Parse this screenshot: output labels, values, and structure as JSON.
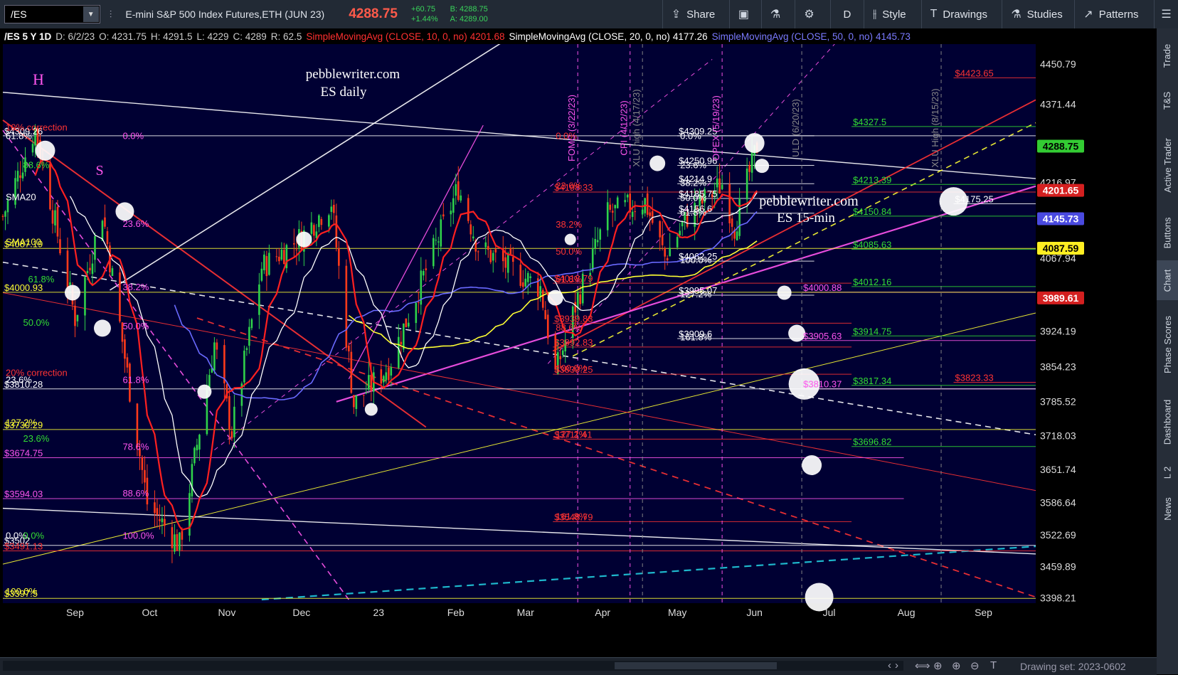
{
  "toolbar": {
    "symbol": "/ES",
    "instrument": "E-mini S&P 500 Index Futures,ETH (JUN 23)",
    "last_price": "4288.75",
    "change": "+60.75",
    "change_pct": "+1.44%",
    "bid": "B: 4288.75",
    "ask": "A: 4289.00",
    "share": "Share",
    "aggregation": "D",
    "style": "Style",
    "drawings": "Drawings",
    "studies": "Studies",
    "patterns": "Patterns"
  },
  "sidebar": [
    "Trade",
    "T&S",
    "Active Trader",
    "Buttons",
    "Chart",
    "Phase Scores",
    "Dashboard",
    "L 2",
    "News"
  ],
  "header": {
    "ident": "/ES 5 Y 1D",
    "date": "D: 6/2/23",
    "open": "O: 4231.75",
    "high": "H: 4291.5",
    "low": "L: 4229",
    "close": "C: 4289",
    "range": "R: 62.5",
    "sma10": "SimpleMovingAvg (CLOSE, 10, 0, no)",
    "sma10_val": "4201.68",
    "sma20": "SimpleMovingAvg (CLOSE, 20, 0, no)",
    "sma20_val": "4177.26",
    "sma50": "SimpleMovingAvg (CLOSE, 50, 0, no)",
    "sma50_val": "4145.73"
  },
  "annotations": {
    "site": "pebblewriter.com",
    "daily": "ES daily",
    "site2": "pebblewriter.com",
    "intraday": "ES 15-min",
    "H": "H",
    "S": "S"
  },
  "footer": {
    "drawing_set": "Drawing set: 2023-0602"
  },
  "colors": {
    "bg": "#000033",
    "up": "#2fd14a",
    "down": "#ff3a1a",
    "sma10": "#ff2020",
    "sma20": "#ffffff",
    "sma50": "#6a6aff",
    "yellow": "#ffff33",
    "pink": "#ff55ee",
    "green": "#33dd33",
    "cyan": "#22ccdd"
  },
  "chart_data": {
    "type": "candlestick",
    "xlabels": [
      "Sep",
      "Oct",
      "Nov",
      "Dec",
      "23",
      "Feb",
      "Mar",
      "Apr",
      "May",
      "Jun",
      "Jul",
      "Aug",
      "Sep"
    ],
    "x_range": [
      "2022-08-03",
      "2023-09-22"
    ],
    "y_ticks": [
      4450.79,
      4371.44,
      4216.97,
      4067.94,
      3924.19,
      3854.23,
      3785.52,
      3718.03,
      3651.74,
      3586.64,
      3522.69,
      3459.89,
      3398.21
    ],
    "y_range": [
      3388,
      4490
    ],
    "price_marker": {
      "value": 4288.75,
      "label": "4288.75",
      "color": "#33cc33"
    },
    "sma10_marker": {
      "value": 4201.65,
      "label": "4201.65",
      "color": "#d42020"
    },
    "sma50_marker": {
      "value": 4145.73,
      "label": "4145.73",
      "color": "#4a4ae0"
    },
    "yellow_marker": {
      "value": 4087.59,
      "label": "4087.59",
      "color": "#ffee22"
    },
    "red_marker": {
      "value": 3989.61,
      "label": "3989.61",
      "color": "#d42020"
    },
    "anchors": [
      [
        "2022-08-03",
        4150
      ],
      [
        "2022-08-16",
        4325
      ],
      [
        "2022-09-01",
        3950
      ],
      [
        "2022-09-12",
        4160
      ],
      [
        "2022-09-30",
        3585
      ],
      [
        "2022-10-13",
        3502
      ],
      [
        "2022-10-27",
        3900
      ],
      [
        "2022-11-03",
        3725
      ],
      [
        "2022-11-15",
        4050
      ],
      [
        "2022-12-01",
        4110
      ],
      [
        "2022-12-13",
        4180
      ],
      [
        "2022-12-22",
        3780
      ],
      [
        "2023-01-05",
        3855
      ],
      [
        "2023-02-02",
        4208
      ],
      [
        "2023-02-10",
        4090
      ],
      [
        "2023-03-07",
        4010
      ],
      [
        "2023-03-13",
        3840
      ],
      [
        "2023-03-22",
        3990
      ],
      [
        "2023-04-03",
        4155
      ],
      [
        "2023-04-18",
        4180
      ],
      [
        "2023-04-26",
        4070
      ],
      [
        "2023-05-05",
        4150
      ],
      [
        "2023-05-19",
        4215
      ],
      [
        "2023-05-24",
        4130
      ],
      [
        "2023-06-02",
        4289
      ]
    ],
    "fib_levels": [
      {
        "value": 4423.65,
        "label": "$4423.65",
        "color": "#ff3333",
        "x1": "2023-08-20",
        "x2": "2023-09-22"
      },
      {
        "value": 4327.5,
        "label": "$4327.5",
        "color": "#33dd33",
        "x1": "2023-07-10",
        "x2": "2023-09-22"
      },
      {
        "value": 4309.26,
        "label": "$4309.26",
        "color": "#ffffff",
        "x1": "2022-08-03",
        "x2": "2023-09-22"
      },
      {
        "value": 4309.25,
        "label": "$4309.25",
        "color": "#ffffff",
        "x1": "2023-05-01",
        "x2": "2023-06-25"
      },
      {
        "value": 4250.96,
        "label": "$4250.96",
        "color": "#ffffff",
        "x1": "2023-05-01",
        "x2": "2023-06-25"
      },
      {
        "value": 4214.9,
        "label": "$4214.9",
        "color": "#ffffff",
        "x1": "2023-05-01",
        "x2": "2023-06-25"
      },
      {
        "value": 4213.39,
        "label": "$4213.39",
        "color": "#33dd33",
        "x1": "2023-07-10",
        "x2": "2023-09-22"
      },
      {
        "value": 4198.33,
        "label": "$4198.33",
        "color": "#ff3333",
        "x1": "2023-03-12",
        "x2": "2023-09-22"
      },
      {
        "value": 4185.75,
        "label": "$4185.75",
        "color": "#ffffff",
        "x1": "2023-05-01",
        "x2": "2023-06-25"
      },
      {
        "value": 4175.25,
        "label": "$4175.25",
        "color": "#ffffff",
        "x1": "2023-08-20",
        "x2": "2023-09-22"
      },
      {
        "value": 4156.6,
        "label": "$4156.6",
        "color": "#ffffff",
        "x1": "2023-05-01",
        "x2": "2023-06-25"
      },
      {
        "value": 4150.84,
        "label": "$4150.84",
        "color": "#33dd33",
        "x1": "2023-07-10",
        "x2": "2023-09-22"
      },
      {
        "value": 4085.63,
        "label": "$4085.63",
        "color": "#33dd33",
        "x1": "2023-07-10",
        "x2": "2023-09-22"
      },
      {
        "value": 4087.19,
        "label": "$4087.19",
        "color": "#ffff33",
        "x1": "2022-08-03",
        "x2": "2023-09-22"
      },
      {
        "value": 4062.25,
        "label": "$4062.25",
        "color": "#ffffff",
        "x1": "2023-05-01",
        "x2": "2023-06-25"
      },
      {
        "value": 4018.79,
        "label": "$4018.79",
        "color": "#ff3333",
        "x1": "2023-03-12",
        "x2": "2023-07-10"
      },
      {
        "value": 4012.16,
        "label": "$4012.16",
        "color": "#33dd33",
        "x1": "2023-07-10",
        "x2": "2023-09-22"
      },
      {
        "value": 4000.88,
        "label": "$4000.88",
        "color": "#ff55ee",
        "x1": "2023-06-20",
        "x2": "2023-09-22"
      },
      {
        "value": 4000.93,
        "label": "$4000.93",
        "color": "#ffff33",
        "x1": "2022-08-03",
        "x2": "2023-09-22"
      },
      {
        "value": 3995.07,
        "label": "$3995.07",
        "color": "#ffffff",
        "x1": "2023-05-01",
        "x2": "2023-06-25"
      },
      {
        "value": 3939.83,
        "label": "$3939.83",
        "color": "#ff3333",
        "x1": "2023-03-12",
        "x2": "2023-07-10"
      },
      {
        "value": 3914.75,
        "label": "$3914.75",
        "color": "#33dd33",
        "x1": "2023-07-10",
        "x2": "2023-09-22"
      },
      {
        "value": 3909.6,
        "label": "$3909.6",
        "color": "#ffffff",
        "x1": "2023-05-01",
        "x2": "2023-06-25"
      },
      {
        "value": 3905.63,
        "label": "$3905.63",
        "color": "#ff55ee",
        "x1": "2023-06-20",
        "x2": "2023-09-22"
      },
      {
        "value": 3892.83,
        "label": "$3892.83",
        "color": "#ff3333",
        "x1": "2023-03-12",
        "x2": "2023-07-10"
      },
      {
        "value": 3839.25,
        "label": "$3839.25",
        "color": "#ff3333",
        "x1": "2023-03-12",
        "x2": "2023-07-10"
      },
      {
        "value": 3823.33,
        "label": "$3823.33",
        "color": "#ff3333",
        "x1": "2023-08-20",
        "x2": "2023-09-22"
      },
      {
        "value": 3817.34,
        "label": "$3817.34",
        "color": "#33dd33",
        "x1": "2023-07-10",
        "x2": "2023-09-22"
      },
      {
        "value": 3810.37,
        "label": "$3810.37",
        "color": "#ff55ee",
        "x1": "2023-06-20",
        "x2": "2023-09-22"
      },
      {
        "value": 3810.28,
        "label": "$3810.28",
        "color": "#ffffff",
        "x1": "2022-08-03",
        "x2": "2023-09-22"
      },
      {
        "value": 3730.29,
        "label": "$3730.29",
        "color": "#ffff33",
        "x1": "2022-08-03",
        "x2": "2023-09-22"
      },
      {
        "value": 3711.41,
        "label": "$3711.41",
        "color": "#ff3333",
        "x1": "2023-03-12",
        "x2": "2023-07-10"
      },
      {
        "value": 3696.82,
        "label": "$3696.82",
        "color": "#33dd33",
        "x1": "2023-07-10",
        "x2": "2023-09-22"
      },
      {
        "value": 3674.75,
        "label": "$3674.75",
        "color": "#ff55ee",
        "x1": "2022-08-03",
        "x2": "2023-07-31"
      },
      {
        "value": 3594.03,
        "label": "$3594.03",
        "color": "#ff55ee",
        "x1": "2022-08-03",
        "x2": "2023-07-31"
      },
      {
        "value": 3548.79,
        "label": "$3548.79",
        "color": "#ff3333",
        "x1": "2023-03-12",
        "x2": "2023-07-10"
      },
      {
        "value": 3502,
        "label": "$3502",
        "color": "#ffffff",
        "x1": "2022-08-03",
        "x2": "2023-09-22"
      },
      {
        "value": 3491.13,
        "label": "$3491.13",
        "color": "#ff3333",
        "x1": "2022-08-03",
        "x2": "2023-09-22"
      },
      {
        "value": 3397.5,
        "label": "$3397.5",
        "color": "#ffff33",
        "x1": "2022-08-03",
        "x2": "2023-09-22"
      }
    ],
    "pct_labels": [
      {
        "t": "2022-08-03",
        "v": 4303,
        "text": "61.8%",
        "color": "#ffffff"
      },
      {
        "t": "2022-09-19",
        "v": 4303,
        "text": "0.0%",
        "color": "#ff55ee"
      },
      {
        "t": "2022-08-10",
        "v": 4245,
        "text": "88.6%",
        "color": "#33dd33"
      },
      {
        "t": "2022-09-19",
        "v": 4130,
        "text": "23.6%",
        "color": "#ff55ee"
      },
      {
        "t": "2022-08-03",
        "v": 4094,
        "text": "SMA100",
        "color": "#ffff33"
      },
      {
        "t": "2022-08-03",
        "v": 4182,
        "text": "SMA20",
        "color": "#ffffff"
      },
      {
        "t": "2022-08-12",
        "v": 4020,
        "text": "61.8%",
        "color": "#33dd33"
      },
      {
        "t": "2022-09-19",
        "v": 4005,
        "text": "38.2%",
        "color": "#ff55ee"
      },
      {
        "t": "2022-08-10",
        "v": 3935,
        "text": "50.0%",
        "color": "#33dd33"
      },
      {
        "t": "2022-09-19",
        "v": 3928,
        "text": "50.0%",
        "color": "#ff55ee"
      },
      {
        "t": "2022-08-03",
        "v": 3822,
        "text": "23.6%",
        "color": "#ffffff"
      },
      {
        "t": "2022-09-19",
        "v": 3822,
        "text": "61.8%",
        "color": "#ff55ee"
      },
      {
        "t": "2022-08-03",
        "v": 3738,
        "text": "127.2%",
        "color": "#ffff33"
      },
      {
        "t": "2022-08-10",
        "v": 3706,
        "text": "23.6%",
        "color": "#33dd33"
      },
      {
        "t": "2022-09-19",
        "v": 3690,
        "text": "78.6%",
        "color": "#ff55ee"
      },
      {
        "t": "2022-09-19",
        "v": 3598,
        "text": "88.6%",
        "color": "#ff55ee"
      },
      {
        "t": "2022-08-03",
        "v": 3515,
        "text": "0.0%",
        "color": "#ffffff"
      },
      {
        "t": "2022-08-10",
        "v": 3515,
        "text": "0.0%",
        "color": "#33dd33"
      },
      {
        "t": "2022-09-19",
        "v": 3515,
        "text": "100.0%",
        "color": "#ff55ee"
      },
      {
        "t": "2022-08-03",
        "v": 3405,
        "text": "100.0%",
        "color": "#ffff33"
      },
      {
        "t": "2022-08-03",
        "v": 4320,
        "text": "10% correction",
        "color": "#ff3333"
      },
      {
        "t": "2022-08-03",
        "v": 3836,
        "text": "20% correction",
        "color": "#ff3333"
      },
      {
        "t": "2023-03-12",
        "v": 4303,
        "text": "0.0%",
        "color": "#ff3333"
      },
      {
        "t": "2023-03-12",
        "v": 4205,
        "text": "23.6%",
        "color": "#ff3333"
      },
      {
        "t": "2023-03-12",
        "v": 4128,
        "text": "38.2%",
        "color": "#ff3333"
      },
      {
        "t": "2023-03-12",
        "v": 4075,
        "text": "50.0%",
        "color": "#ff3333"
      },
      {
        "t": "2023-03-12",
        "v": 4020,
        "text": "61.8%",
        "color": "#ff3333"
      },
      {
        "t": "2023-03-12",
        "v": 3925,
        "text": "88.6%",
        "color": "#ff3333"
      },
      {
        "t": "2023-03-12",
        "v": 3845,
        "text": "100.0%",
        "color": "#ff3333"
      },
      {
        "t": "2023-03-12",
        "v": 3715,
        "text": "127.2%",
        "color": "#ff3333"
      },
      {
        "t": "2023-03-12",
        "v": 3553,
        "text": "161.8%",
        "color": "#ff3333"
      },
      {
        "t": "2023-05-01",
        "v": 4303,
        "text": "0.0%",
        "color": "#ffffff"
      },
      {
        "t": "2023-05-01",
        "v": 4245,
        "text": "23.6%",
        "color": "#ffffff"
      },
      {
        "t": "2023-05-01",
        "v": 4210,
        "text": "38.2%",
        "color": "#ffffff"
      },
      {
        "t": "2023-05-01",
        "v": 4181,
        "text": "50.0%",
        "color": "#ffffff"
      },
      {
        "t": "2023-05-01",
        "v": 4152,
        "text": "61.8%",
        "color": "#ffffff"
      },
      {
        "t": "2023-05-01",
        "v": 4058,
        "text": "100.0%",
        "color": "#ffffff"
      },
      {
        "t": "2023-05-01",
        "v": 3991,
        "text": "127.2%",
        "color": "#ffffff"
      },
      {
        "t": "2023-05-01",
        "v": 3906,
        "text": "161.8%",
        "color": "#ffffff"
      }
    ],
    "events": [
      {
        "t": "2023-03-22",
        "text": "FOMC (3/22/23)",
        "color": "#ff55ee"
      },
      {
        "t": "2023-04-12",
        "text": "CPI (4/12/23)",
        "color": "#ff55ee"
      },
      {
        "t": "2023-04-17",
        "text": "XLU high (4/17/23)",
        "color": "#888888"
      },
      {
        "t": "2023-05-19",
        "text": "OPEX (5/19/23)",
        "color": "#ff55ee"
      },
      {
        "t": "2023-06-20",
        "text": "ULD (6/20/23)",
        "color": "#888888"
      },
      {
        "t": "2023-08-15",
        "text": "XLU High (8/15/23)",
        "color": "#888888"
      }
    ],
    "circles": [
      {
        "t": "2022-08-20",
        "v": 4280,
        "r": 14
      },
      {
        "t": "2022-09-21",
        "v": 4160,
        "r": 13
      },
      {
        "t": "2022-08-31",
        "v": 4000,
        "r": 11
      },
      {
        "t": "2022-09-12",
        "v": 3930,
        "r": 12
      },
      {
        "t": "2022-10-23",
        "v": 3805,
        "r": 10
      },
      {
        "t": "2022-12-02",
        "v": 4105,
        "r": 11
      },
      {
        "t": "2022-12-29",
        "v": 3770,
        "r": 9
      },
      {
        "t": "2023-03-13",
        "v": 3990,
        "r": 11
      },
      {
        "t": "2023-03-19",
        "v": 4105,
        "r": 8
      },
      {
        "t": "2023-04-23",
        "v": 4255,
        "r": 11
      },
      {
        "t": "2023-06-01",
        "v": 4295,
        "r": 14
      },
      {
        "t": "2023-06-04",
        "v": 4250,
        "r": 10
      },
      {
        "t": "2023-06-13",
        "v": 4000,
        "r": 10
      },
      {
        "t": "2023-06-18",
        "v": 3920,
        "r": 12
      },
      {
        "t": "2023-06-21",
        "v": 3820,
        "r": 22
      },
      {
        "t": "2023-06-24",
        "v": 3660,
        "r": 14
      },
      {
        "t": "2023-06-27",
        "v": 3400,
        "r": 20
      },
      {
        "t": "2023-08-20",
        "v": 4180,
        "r": 20
      }
    ]
  }
}
